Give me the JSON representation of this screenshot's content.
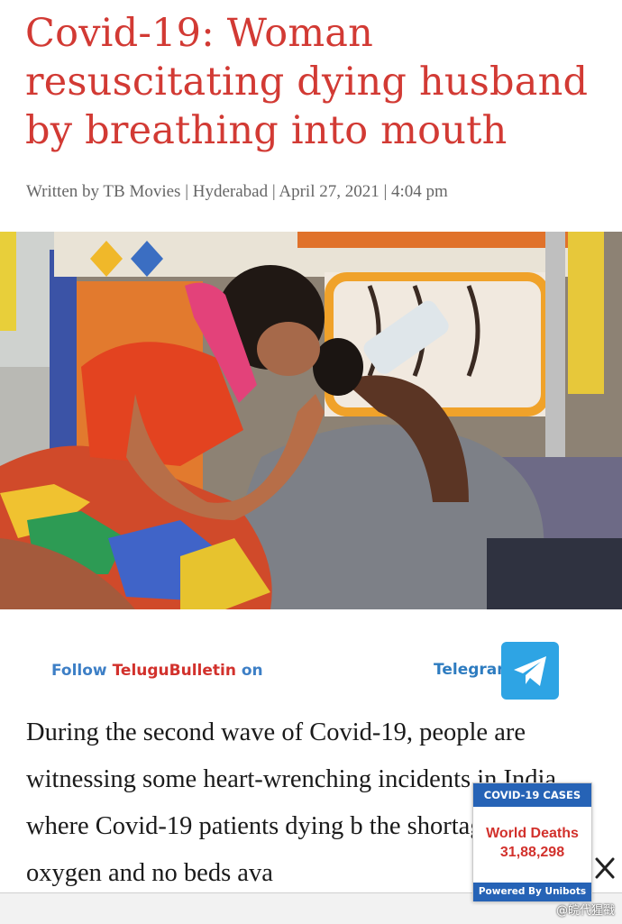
{
  "article": {
    "title": "Covid-19: Woman resuscitating dying husband by breathing into mouth",
    "byline": "Written by TB Movies | Hyderabad | April 27, 2021 | 4:04 pm",
    "body_text": "During the second wave of Covid-19, people are witnessing some heart-wrenching incidents in India, where Covid-19 patients dying b the shortage of oxygen and no beds ava"
  },
  "follow_bar": {
    "follow_word": "Follow",
    "brand": "TeluguBulletin",
    "on_word": "on",
    "telegram_label": "Telegram",
    "telegram_icon": "telegram-paper-plane-icon"
  },
  "covid_widget": {
    "header": "COVID-19 CASES",
    "label": "World Deaths",
    "value": "31,88,298",
    "footer": "Powered By Unibots",
    "close_icon": "close-icon"
  },
  "watermark": "@皖代猩戳",
  "colors": {
    "headline_red": "#d23a34",
    "widget_blue": "#2663b6",
    "telegram_blue": "#2ea4e4",
    "brand_red": "#d2312c",
    "link_blue": "#3d7fc6"
  }
}
